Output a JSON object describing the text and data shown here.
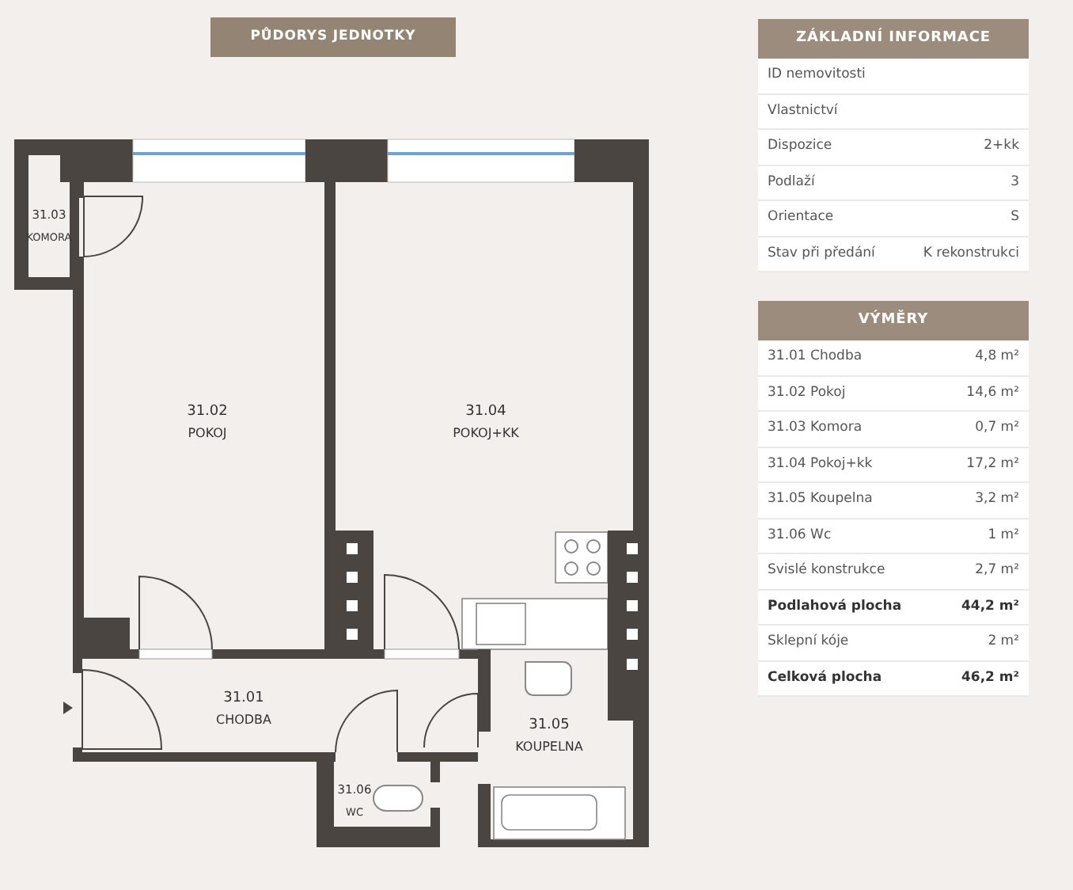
{
  "plan": {
    "title": "PŮDORYS JEDNOTKY",
    "rooms": [
      {
        "number": "31.03",
        "name": "KOMORA"
      },
      {
        "number": "31.02",
        "name": "POKOJ"
      },
      {
        "number": "31.04",
        "name": "POKOJ+KK"
      },
      {
        "number": "31.01",
        "name": "CHODBA"
      },
      {
        "number": "31.05",
        "name": "KOUPELNA"
      },
      {
        "number": "31.06",
        "name": "WC"
      }
    ]
  },
  "info": {
    "title": "ZÁKLADNÍ INFORMACE",
    "rows": [
      {
        "label": "ID nemovitosti"
      },
      {
        "label": "Vlastnictví"
      },
      {
        "label": "Dispozice",
        "value": "2+kk"
      },
      {
        "label": "Podlaží",
        "value": "3"
      },
      {
        "label": "Orientace",
        "value": "S"
      },
      {
        "label": "Stav při předání",
        "value": "K rekonstrukci"
      }
    ]
  },
  "areas": {
    "title": "VÝMĚRY",
    "rows": [
      {
        "label": "31.01 Chodba",
        "value": "4,8 m²",
        "emphasized": false
      },
      {
        "label": "31.02 Pokoj",
        "value": "14,6 m²",
        "emphasized": false
      },
      {
        "label": "31.03 Komora",
        "value": "0,7 m²",
        "emphasized": false
      },
      {
        "label": "31.04 Pokoj+kk",
        "value": "17,2 m²",
        "emphasized": false
      },
      {
        "label": "31.05 Koupelna",
        "value": "3,2 m²",
        "emphasized": false
      },
      {
        "label": "31.06 Wc",
        "value": "1 m²",
        "emphasized": false
      },
      {
        "label": "Svislé konstrukce",
        "value": "2,7 m²",
        "emphasized": false
      },
      {
        "label": "Podlahová plocha",
        "value": "44,2 m²",
        "emphasized": true
      },
      {
        "label": "Sklepní kóje",
        "value": "2 m²",
        "emphasized": false
      },
      {
        "label": "Celková plocha",
        "value": "46,2 m²",
        "emphasized": true
      }
    ]
  }
}
